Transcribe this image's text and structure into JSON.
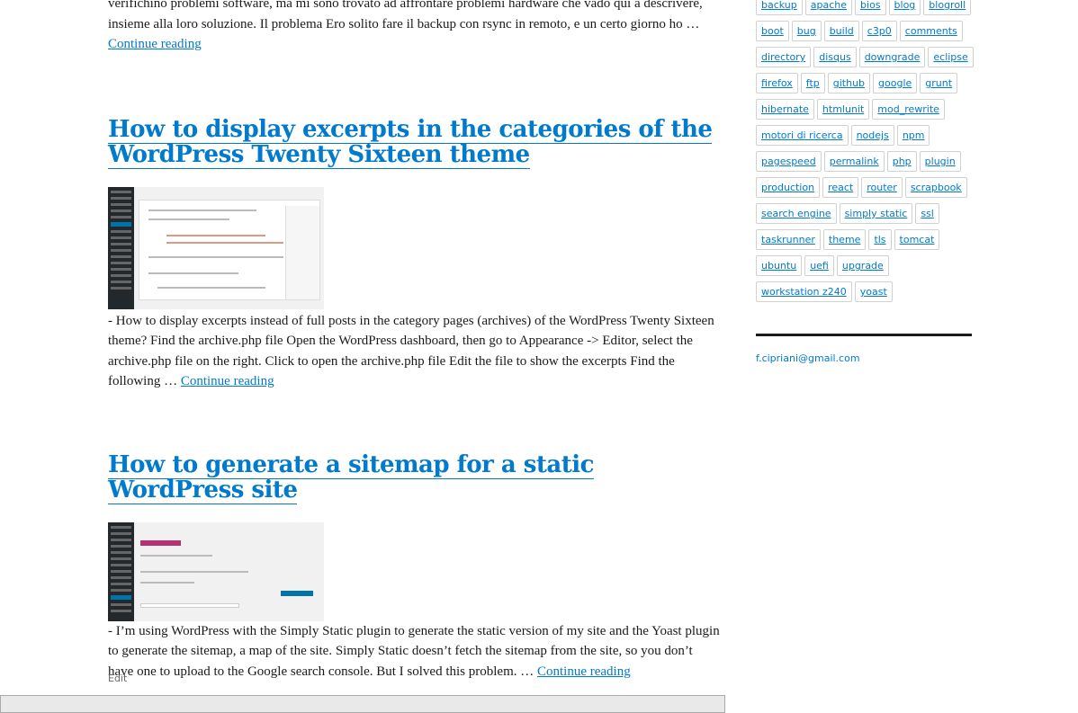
{
  "posts": [
    {
      "excerpt": "verifichino problemi software, ma mi sono trovato ad affrontare problemi hardware che vado qui a descrivere, insieme alla loro soluzione. Il problema Ero solito fare il backup con rsync in remoto, e un certo giorno ho … ",
      "more": "Continue reading"
    },
    {
      "title": "How to display excerpts in the categories of the WordPress Twenty Sixteen theme",
      "thumb": "Edit Themes screenshot",
      "excerpt": "- How to display excerpts instead of full posts in the category pages (archives) of the WordPress Twenty Sixteen theme? Find the archive.php file Open the WordPress dashboard, then go to Appearance -> Editor, select the archive.php file on the right. Click to open the archive.php file Edit the file to show the excerpts Find the following … ",
      "more": "Continue reading"
    },
    {
      "title": "How to generate a sitemap for a static WordPress site",
      "thumb": "XML Sitemaps - Yoast SEO screenshot",
      "excerpt": "- I’m using WordPress with the Simply Static plugin to generate the static version of my site and the Yoast plugin to generate the sitemap, a map of the site. Simply Static doesn’t fetch the sitemap from the site, so you don’t have one to upload to the Google search console. But I solved this problem. … ",
      "more": "Continue reading"
    }
  ],
  "edit_label": "Edit",
  "tags": [
    "backup",
    "apache",
    "bios",
    "blog",
    "blogroll",
    "boot",
    "bug",
    "build",
    "c3p0",
    "comments",
    "directory",
    "disqus",
    "downgrade",
    "eclipse",
    "firefox",
    "ftp",
    "github",
    "google",
    "grunt",
    "hibernate",
    "htmlunit",
    "mod_rewrite",
    "motori di ricerca",
    "nodejs",
    "npm",
    "pagespeed",
    "permalink",
    "php",
    "plugin",
    "production",
    "react",
    "router",
    "scrapbook",
    "search engine",
    "simply static",
    "ssl",
    "taskrunner",
    "theme",
    "tls",
    "tomcat",
    "ubuntu",
    "uefi",
    "upgrade",
    "workstation z240",
    "yoast"
  ],
  "email": "f.cipriani@gmail.com",
  "colors": {
    "link": "#007acc",
    "text": "#1a1a1a"
  }
}
